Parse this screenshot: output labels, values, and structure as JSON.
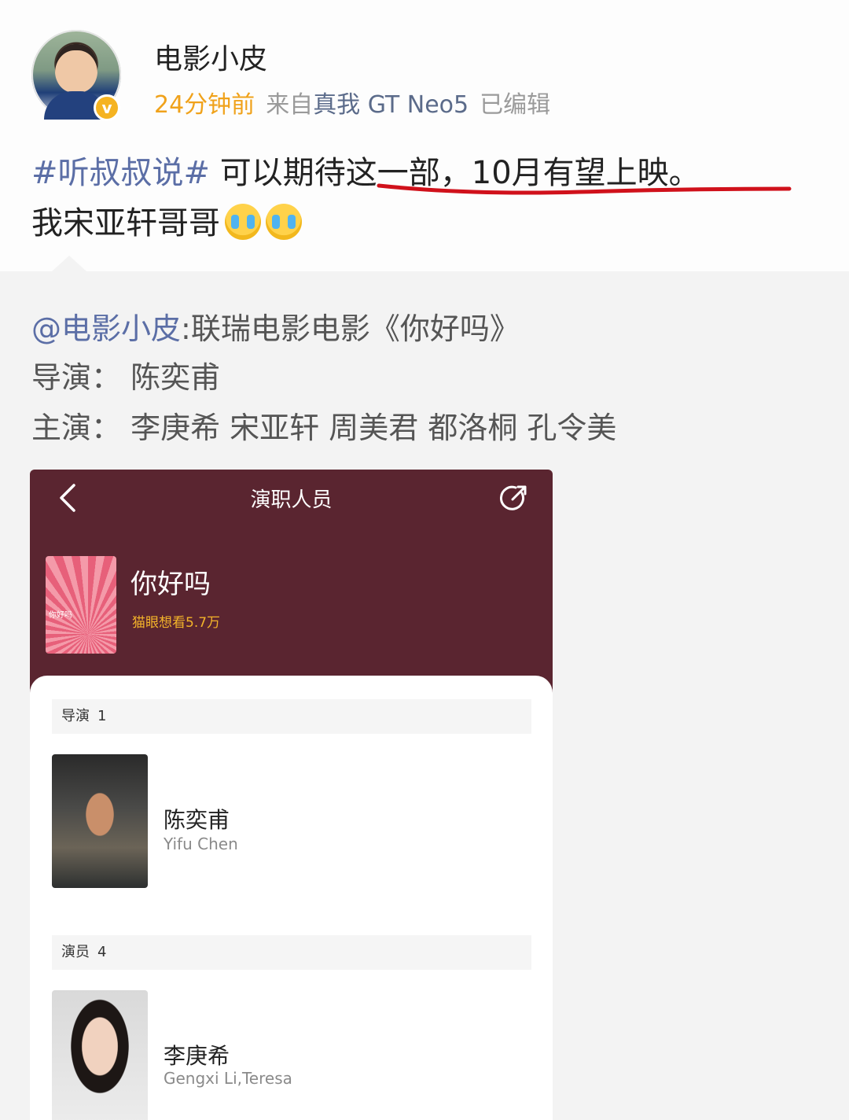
{
  "post": {
    "username": "电影小皮",
    "time": "24分钟前",
    "source_prefix": "来自",
    "device": "真我 GT Neo5",
    "edited": "已编辑",
    "hashtag": "#听叔叔说#",
    "text_part1": " 可以期待这一部，10月有望上映。",
    "text_part2": "我宋亚轩哥哥",
    "emoji": "crying-face-icon"
  },
  "repost": {
    "mention": "@电影小皮",
    "title_text": ":联瑞电影电影《你好吗》",
    "director_line": "导演： 陈奕甫",
    "cast_line": "主演： 李庚希 宋亚轩 周美君 都洛桐 孔令美"
  },
  "card": {
    "header_title": "演职人员",
    "movie_name": "你好吗",
    "poster_text": "你好吗",
    "want_to_see": "猫眼想看5.7万",
    "director_section": {
      "label": "导演",
      "count": "1"
    },
    "director": {
      "name": "陈奕甫",
      "en_name": "Yifu Chen"
    },
    "actor_section": {
      "label": "演员",
      "count": "4"
    },
    "actor": {
      "name": "李庚希",
      "en_name": "Gengxi Li,Teresa"
    }
  },
  "colors": {
    "hashtag": "#5b6ea6",
    "time": "#f0a21b",
    "card_bg": "#5a2530",
    "want_to_see": "#f3b32a",
    "underline": "#d0111b"
  }
}
